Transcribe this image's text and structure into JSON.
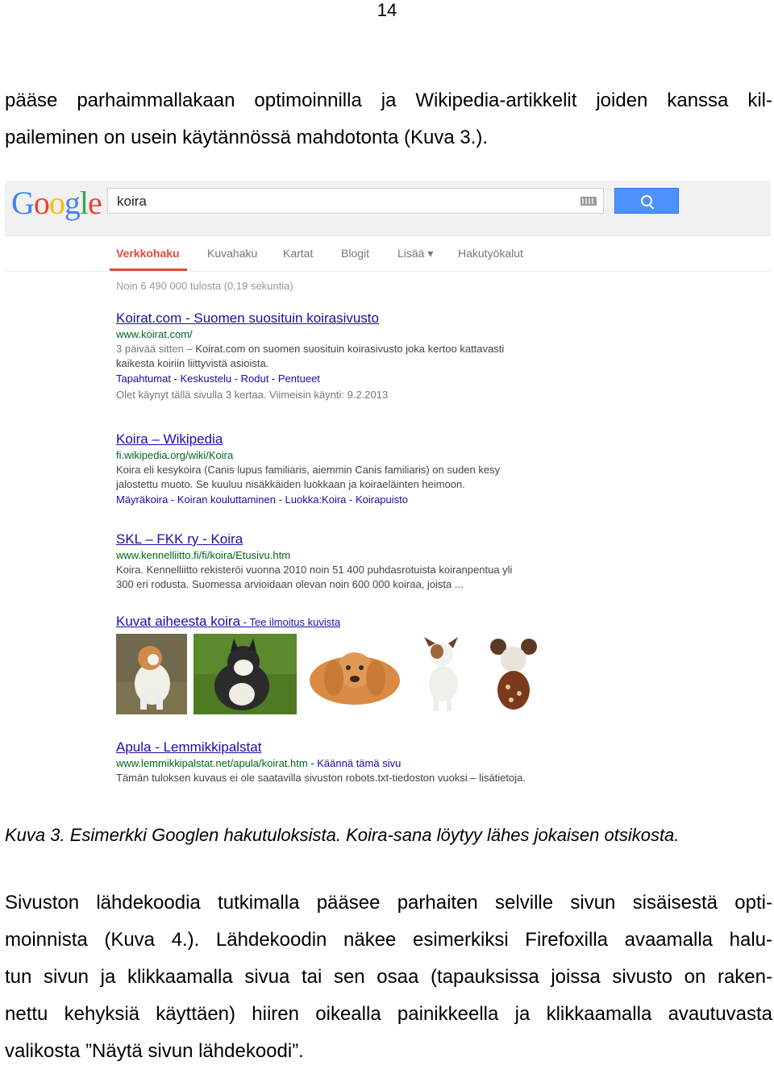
{
  "page_number": "14",
  "paragraph1": {
    "lines": [
      "pääse parhaimmallakaan optimoinnilla ja Wikipedia-artikkelit joiden kanssa kil-",
      "paileminen on usein käytännössä mahdotonta (Kuva 3.)."
    ]
  },
  "figure": {
    "logo": [
      "G",
      "o",
      "o",
      "g",
      "l",
      "e"
    ],
    "search_query": "koira",
    "tabs": [
      "Verkkohaku",
      "Kuvahaku",
      "Kartat",
      "Blogit",
      "Lisää ▾",
      "Hakutyökalut"
    ],
    "stats": "Noin 6 490 000 tulosta (0,19 sekuntia)",
    "result1": {
      "title": "Koirat.com - Suomen suosituin koirasivusto",
      "url": "www.koirat.com/",
      "snippet1_date": "3 päivää sitten – ",
      "snippet1": "Koirat.com on suomen suosituin koirasivusto joka kertoo kattavasti",
      "snippet2": "kaikesta koiriin liittyvistä asioista.",
      "links": "Tapahtumat - Keskustelu - Rodut - Pentueet",
      "note": "Olet käynyt tällä sivulla 3 kertaa. Viimeisin käynti: 9.2.2013"
    },
    "result2": {
      "title": "Koira – Wikipedia",
      "url": "fi.wikipedia.org/wiki/Koira",
      "snippet1": "Koira eli kesykoira (Canis lupus familiaris, aiemmin Canis familiaris) on suden kesy",
      "snippet2": "jalostettu muoto. Se kuuluu nisäkkäiden luokkaan ja koiraeläinten heimoon.",
      "links": "Mäyräkoira - Koiran kouluttaminen - Luokka:Koira - Koirapuisto"
    },
    "result3": {
      "title": "SKL – FKK ry - Koira",
      "url": "www.kennelliitto.fi/fi/koira/Etusivu.htm",
      "snippet1": "Koira. Kennelliitto rekisteröi vuonna 2010 noin 51 400 puhdasrotuista koiranpentua yli",
      "snippet2": "300 eri rodusta. Suomessa arvioidaan olevan noin 600 000 koiraa, joista ..."
    },
    "images": {
      "title": "Kuvat aiheesta koira",
      "report": " - Tee ilmoitus kuvista"
    },
    "result4": {
      "title": "Apula - Lemmikkipalstat",
      "url": "www.lemmikkipalstat.net/apula/koirat.htm",
      "translate": " - Käännä tämä sivu",
      "snippet1": "Tämän tuloksen kuvaus ei ole saatavilla sivuston robots.txt-tiedoston vuoksi – lisätietoja."
    },
    "colors": {
      "link": "#1a0dab",
      "url": "#006621",
      "active_tab": "#dd4b39",
      "button": "#4d90fe"
    }
  },
  "caption": "Kuva 3. Esimerkki Googlen hakutuloksista. Koira-sana löytyy lähes jokaisen otsikosta.",
  "paragraph2": {
    "lines": [
      "Sivuston lähdekoodia tutkimalla pääsee parhaiten selville sivun sisäisestä opti-",
      "moinnista (Kuva 4.). Lähdekoodin näkee esimerkiksi Firefoxilla avaamalla halu-",
      "tun sivun ja klikkaamalla sivua tai sen osaa (tapauksissa joissa sivusto on raken-",
      "nettu kehyksiä käyttäen) hiiren oikealla painikkeella ja klikkaamalla avautuvasta",
      "valikosta ”Näytä sivun lähdekoodi”."
    ]
  }
}
